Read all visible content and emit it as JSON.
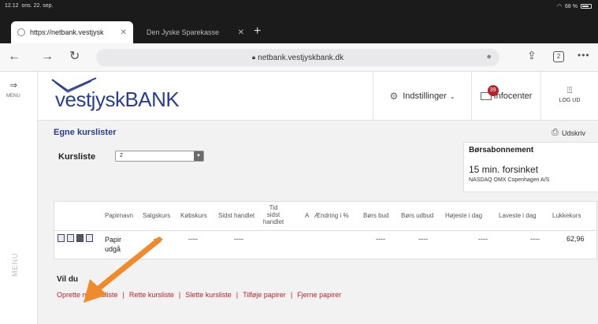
{
  "status": {
    "time": "12.12",
    "date": "ons. 22. sep.",
    "battery": "68 %"
  },
  "tabs": [
    {
      "title": "https://netbank.vestjysk",
      "active": true
    },
    {
      "title": "Den Jyske Sparekasse",
      "active": false
    }
  ],
  "address": {
    "url": "netbank.vestjyskbank.dk",
    "tab_count": "2"
  },
  "side_menu": {
    "label": "MENU",
    "vertical_label": "MENU"
  },
  "bank": {
    "logo_prefix": "vestjysk",
    "logo_suffix": "BANK",
    "settings_label": "Indstillinger",
    "info_label": "Infocenter",
    "info_badge": "39",
    "logout_label": "LOG UD"
  },
  "page": {
    "title": "Egne kurslister",
    "print_label": "Udskriv",
    "kursliste_label": "Kursliste",
    "kursliste_value": "2"
  },
  "bors": {
    "heading": "Børsabonnement",
    "delay": "15 min. forsinket",
    "source": "NASDAQ OMX Copenhagen A/S"
  },
  "table": {
    "headers": {
      "papirnavn": "Papirnavn",
      "salgskurs": "Salgskurs",
      "kobskurs": "Købskurs",
      "sidst_handlet": "Sidst handlet",
      "tid_sidst_handlet": "Tid sidst handlet",
      "a": "A",
      "aendring": "Ændring i %",
      "bors_bud": "Børs bud",
      "bors_udbud": "Børs udbud",
      "hojeste": "Højeste i dag",
      "laveste": "Laveste i dag",
      "lukkekurs": "Lukkekurs"
    },
    "row": {
      "name_line1": "Papir",
      "name_line2": "udgå",
      "salgskurs": "----",
      "kobskurs": "----",
      "sidst_handlet": "----",
      "bors_bud": "----",
      "bors_udbud": "----",
      "hojeste": "----",
      "laveste": "----",
      "lukkekurs": "62,96"
    }
  },
  "actions": {
    "heading": "Vil du",
    "links": [
      "Oprette ny kursliste",
      "Rette kursliste",
      "Slette kursliste",
      "Tilføje papirer",
      "Fjerne papirer"
    ]
  },
  "colors": {
    "brand": "#2a3e8a",
    "link": "#b8252c",
    "annotation_arrow": "#f08a2c"
  }
}
